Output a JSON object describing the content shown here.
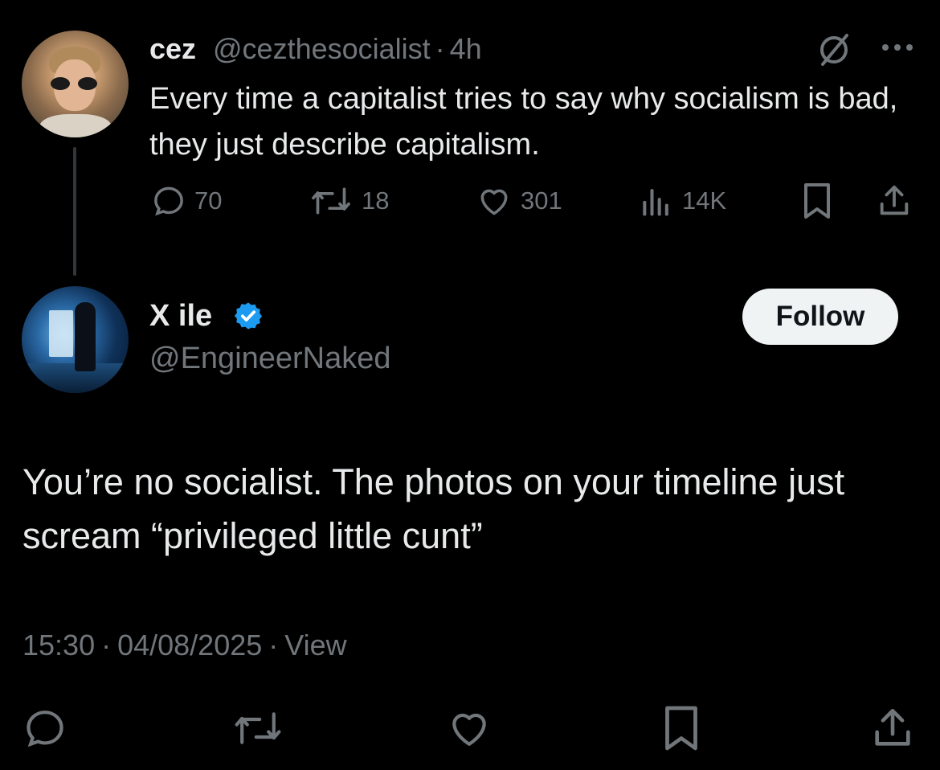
{
  "parent_tweet": {
    "display_name": "cez",
    "handle": "@cezthesocialist",
    "separator": "·",
    "time_ago": "4h",
    "text": "Every time a capitalist tries to say why socialism is bad, they just describe capitalism.",
    "replies": "70",
    "reposts": "18",
    "likes": "301",
    "views": "14K",
    "icons": [
      "grok-icon",
      "more-icon",
      "reply-icon",
      "repost-icon",
      "like-icon",
      "views-icon",
      "bookmark-icon",
      "share-icon"
    ]
  },
  "reply_tweet": {
    "display_name": "X ile",
    "handle": "@EngineerNaked",
    "follow_label": "Follow",
    "text": "You’re no socialist. The photos on your timeline just scream “privileged little cunt”",
    "time": "15:30",
    "date": "04/08/2025",
    "separator": "·",
    "view_label": "View",
    "icons": [
      "verified-icon",
      "reply-icon",
      "repost-icon",
      "like-icon",
      "bookmark-icon",
      "share-icon"
    ]
  },
  "colors": {
    "background": "#000000",
    "primary_text": "#e7e9ea",
    "secondary_text": "#71767b",
    "verified_blue": "#1d9bf0",
    "follow_button_bg": "#eff3f4"
  }
}
